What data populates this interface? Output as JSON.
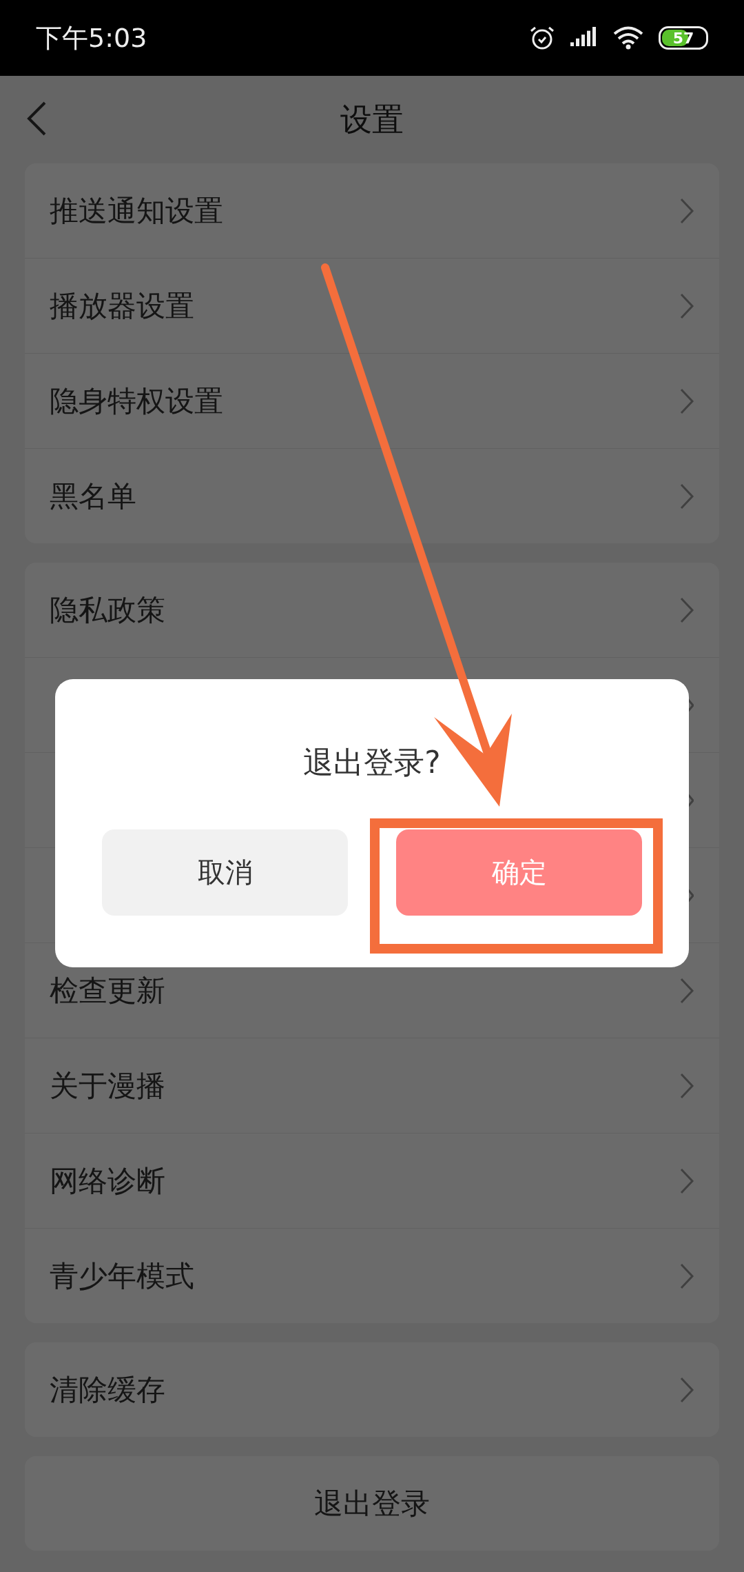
{
  "status_bar": {
    "time": "下午5:03",
    "battery": "57"
  },
  "header": {
    "title": "设置"
  },
  "groups": [
    {
      "items": [
        {
          "kind": "link",
          "label": "推送通知设置"
        },
        {
          "kind": "link",
          "label": "播放器设置"
        },
        {
          "kind": "link",
          "label": "隐身特权设置"
        },
        {
          "kind": "link",
          "label": "黑名单"
        }
      ]
    },
    {
      "items": [
        {
          "kind": "link",
          "label": "隐私政策"
        },
        {
          "kind": "covered"
        },
        {
          "kind": "covered"
        },
        {
          "kind": "covered"
        },
        {
          "kind": "link",
          "label": "检查更新"
        },
        {
          "kind": "link",
          "label": "关于漫播"
        },
        {
          "kind": "link",
          "label": "网络诊断"
        },
        {
          "kind": "link",
          "label": "青少年模式"
        }
      ]
    },
    {
      "items": [
        {
          "kind": "link",
          "label": "清除缓存"
        }
      ]
    }
  ],
  "logout_button": "退出登录",
  "dialog": {
    "title": "退出登录?",
    "buttons": [
      {
        "label": "取消",
        "kind": "cancel"
      },
      {
        "label": "确定",
        "kind": "confirm"
      }
    ]
  }
}
